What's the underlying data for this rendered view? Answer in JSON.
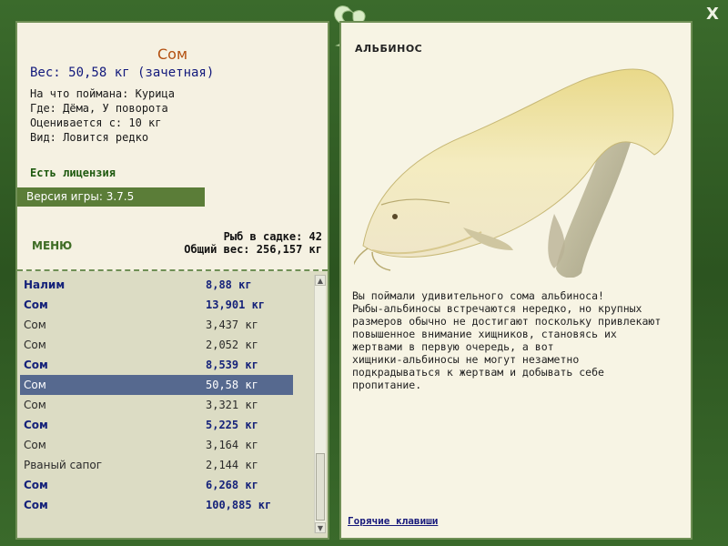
{
  "fish": {
    "name": "Сом",
    "weight_line": "Вес: 50,58 кг (зачетная)",
    "bait": "На что поймана: Курица",
    "place": "Где: Дёма, У поворота",
    "rated_from": "Оценивается с: 10 кг",
    "kind": "Вид: Ловится редко"
  },
  "license": "Есть лицензия",
  "version": "Версия игры: 3.7.5",
  "menu_label": "МЕНЮ",
  "stats": {
    "count": "Рыб в садке: 42",
    "total": "Общий вес: 256,157 кг"
  },
  "catch_list": [
    {
      "name": "Налим",
      "weight": "8,88 кг",
      "style": "bold"
    },
    {
      "name": "Сом",
      "weight": "13,901 кг",
      "style": "bold"
    },
    {
      "name": "Сом",
      "weight": "3,437 кг",
      "style": "plain"
    },
    {
      "name": "Сом",
      "weight": "2,052 кг",
      "style": "plain"
    },
    {
      "name": "Сом",
      "weight": "8,539 кг",
      "style": "bold"
    },
    {
      "name": "Сом",
      "weight": "50,58 кг",
      "style": "selected"
    },
    {
      "name": "Сом",
      "weight": "3,321 кг",
      "style": "plain"
    },
    {
      "name": "Сом",
      "weight": "5,225 кг",
      "style": "bold"
    },
    {
      "name": "Сом",
      "weight": "3,164 кг",
      "style": "plain"
    },
    {
      "name": "Рваный сапог",
      "weight": "2,144 кг",
      "style": "plain"
    },
    {
      "name": "Сом",
      "weight": "6,268 кг",
      "style": "bold"
    },
    {
      "name": "Сом",
      "weight": "100,885 кг",
      "style": "bold"
    }
  ],
  "right": {
    "title": "АЛЬБИНОС",
    "description_lines": [
      "Вы поймали удивительного сома альбиноса!",
      "Рыбы-альбиносы встречаются нередко, но крупных",
      "размеров обычно не достигают поскольку привлекают",
      "повышенное внимание хищников, становясь их",
      "жертвами в первую очередь, а вот",
      "хищники-альбиносы не могут незаметно",
      "подкрадываться к жертвам и добывать себе",
      "пропитание."
    ],
    "hotkeys": "Горячие клавиши"
  },
  "close_label": "X",
  "colors": {
    "frame": "#2f5a23",
    "panel": "#f5f1e2",
    "name_color": "#b35010",
    "bold_row": "#15227a",
    "selected_row": "#56698f"
  },
  "icons": [
    "fish-logo-icon",
    "close-icon",
    "scroll-up-icon",
    "scroll-down-icon"
  ]
}
